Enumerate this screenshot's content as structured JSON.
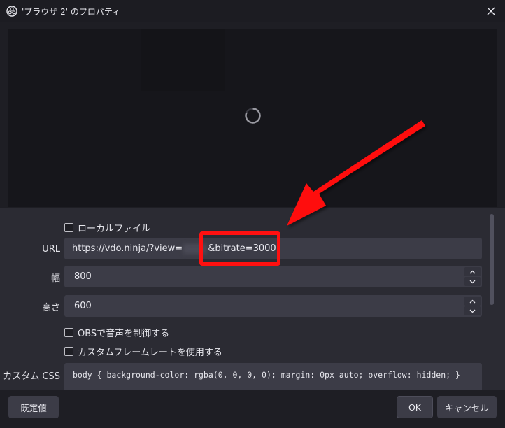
{
  "window": {
    "title": "'ブラウザ 2' のプロパティ"
  },
  "properties": {
    "local_file": {
      "label": "ローカルファイル",
      "checked": false
    },
    "url": {
      "label": "URL",
      "value_prefix": "https://vdo.ninja/?view=",
      "value_suffix": "&bitrate=3000"
    },
    "width": {
      "label": "幅",
      "value": "800"
    },
    "height": {
      "label": "高さ",
      "value": "600"
    },
    "control_audio": {
      "label": "OBSで音声を制御する",
      "checked": false
    },
    "custom_framerate": {
      "label": "カスタムフレームレートを使用する",
      "checked": false
    },
    "custom_css": {
      "label": "カスタム CSS",
      "value": "body { background-color: rgba(0, 0, 0, 0); margin: 0px auto; overflow: hidden; }"
    }
  },
  "footer": {
    "defaults_label": "既定値",
    "ok_label": "OK",
    "cancel_label": "キャンセル"
  },
  "colors": {
    "annotation": "#ff1010",
    "panel": "#2b2b33",
    "field": "#3c3c47"
  },
  "icons": {
    "app": "obs-logo-icon",
    "close": "close-icon",
    "loading": "spinner-icon"
  }
}
